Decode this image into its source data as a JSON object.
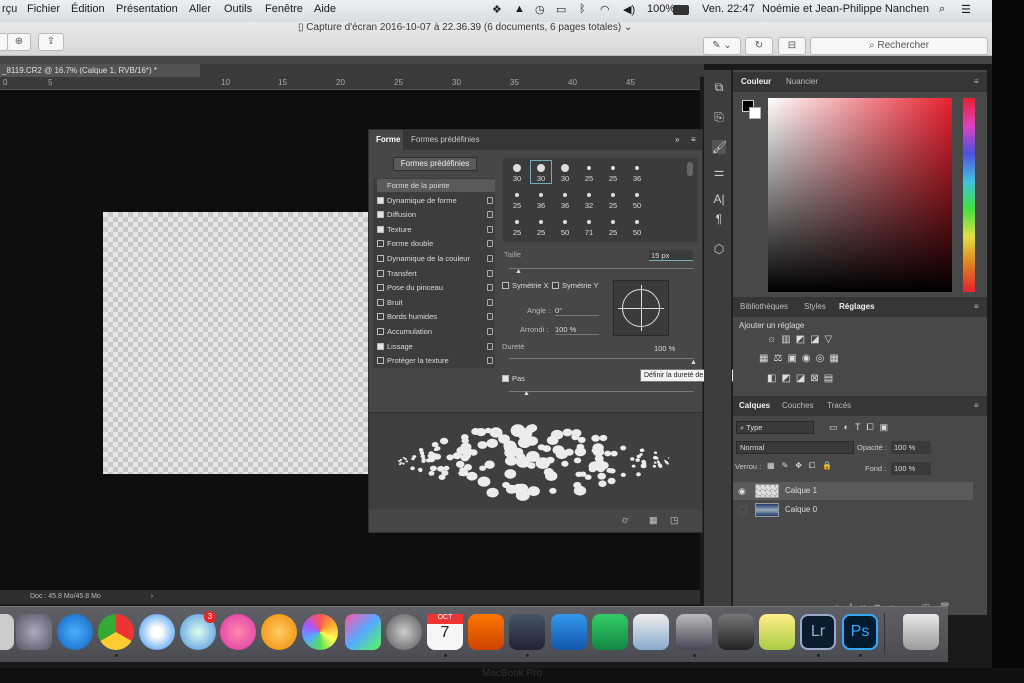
{
  "menubar": {
    "app": "rçu",
    "items": [
      "Fichier",
      "Édition",
      "Présentation",
      "Aller",
      "Outils",
      "Fenêtre",
      "Aide"
    ],
    "battery": "100%",
    "clock": "Ven. 22:47",
    "user": "Noémie et Jean-Philippe Nanchen"
  },
  "window": {
    "title": "Capture d'écran 2016-10-07 à 22.36.39 (6 documents, 6 pages totales)",
    "search_placeholder": "Rechercher"
  },
  "document": {
    "tab": "_8119.CR2 @ 16.7% (Calque 1, RVB/16*) *",
    "ruler": [
      "0",
      "5",
      "10",
      "15",
      "20",
      "25",
      "30",
      "35",
      "40",
      "45"
    ],
    "status": "Doc : 45.8 Mo/45.8 Mo"
  },
  "brush": {
    "tabs": [
      "Forme",
      "Formes prédéfinies"
    ],
    "preset_button": "Formes prédéfinies",
    "items": [
      {
        "label": "Forme de la pointe",
        "check": null
      },
      {
        "label": "Dynamique de forme",
        "check": true
      },
      {
        "label": "Diffusion",
        "check": true
      },
      {
        "label": "Texture",
        "check": true
      },
      {
        "label": "Forme double",
        "check": false
      },
      {
        "label": "Dynamique de la couleur",
        "check": false
      },
      {
        "label": "Transfert",
        "check": false
      },
      {
        "label": "Pose du pinceau",
        "check": false
      },
      {
        "label": "Bruit",
        "check": false
      },
      {
        "label": "Bords humides",
        "check": false
      },
      {
        "label": "Accumulation",
        "check": false
      },
      {
        "label": "Lissage",
        "check": true
      },
      {
        "label": "Protéger la texture",
        "check": false
      }
    ],
    "tips": [
      [
        "30",
        "30",
        "30",
        "25",
        "25",
        "36"
      ],
      [
        "25",
        "36",
        "36",
        "32",
        "25",
        "50"
      ],
      [
        "25",
        "25",
        "50",
        "71",
        "25",
        "50"
      ]
    ],
    "size_label": "Taille",
    "size_value": "15 px",
    "symx": "Symétrie X",
    "symy": "Symétrie Y",
    "angle_label": "Angle :",
    "angle_value": "0°",
    "round_label": "Arrondi :",
    "round_value": "100 %",
    "hard_label": "Dureté",
    "hard_value": "100 %",
    "tooltip": "Définir la dureté de la forme",
    "spacing_label": "Pas"
  },
  "color": {
    "tabs": [
      "Couleur",
      "Nuancier"
    ]
  },
  "adjust": {
    "tabs": [
      "Bibliothèques",
      "Styles",
      "Réglages"
    ],
    "title": "Ajouter un réglage"
  },
  "layers": {
    "tabs": [
      "Calques",
      "Couches",
      "Tracés"
    ],
    "filter": "Type",
    "blend": "Normal",
    "opacity_label": "Opacité :",
    "opacity": "100 %",
    "lock_label": "Verrou :",
    "fill_label": "Fond :",
    "fill": "100 %",
    "items": [
      "Calque 1",
      "Calque 0"
    ]
  },
  "dock": {
    "badge": "3",
    "calendar_month": "OCT",
    "calendar_day": "7",
    "lr": "Lr",
    "ps": "Ps"
  },
  "bezel": "MacBook Pro"
}
